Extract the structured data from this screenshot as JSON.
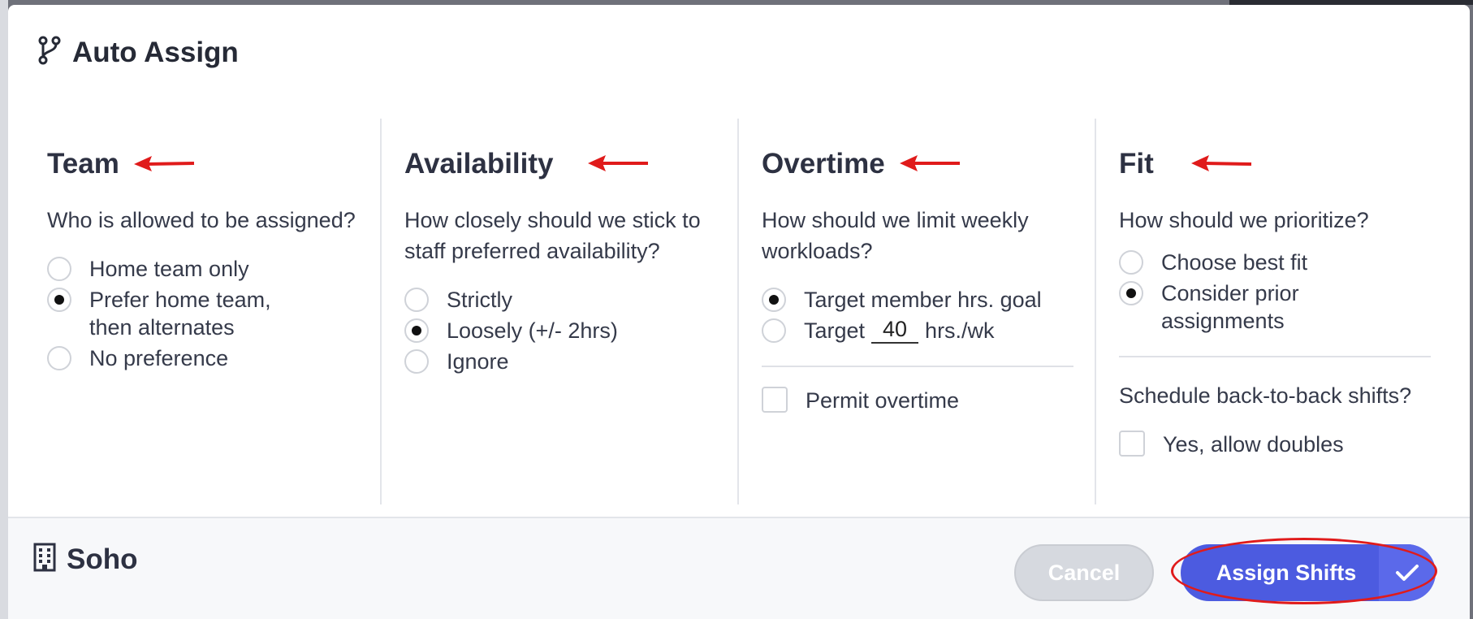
{
  "dialog": {
    "title": "Auto Assign",
    "title_icon": "branch-icon"
  },
  "columns": {
    "team": {
      "heading": "Team",
      "question": "Who is allowed to be assigned?",
      "options": [
        {
          "label": "Home team only",
          "checked": false
        },
        {
          "label": "Prefer home team, then alternates",
          "checked": true
        },
        {
          "label": "No preference",
          "checked": false
        }
      ]
    },
    "availability": {
      "heading": "Availability",
      "question": "How closely should we stick to staff preferred availability?",
      "options": [
        {
          "label": "Strictly",
          "checked": false
        },
        {
          "label": "Loosely (+/- 2hrs)",
          "checked": true
        },
        {
          "label": "Ignore",
          "checked": false
        }
      ]
    },
    "overtime": {
      "heading": "Overtime",
      "question": "How should we limit weekly workloads?",
      "options": [
        {
          "label": "Target member hrs. goal",
          "checked": true
        },
        {
          "label_before": "Target",
          "value": "40",
          "label_after": "hrs./wk",
          "checked": false
        }
      ],
      "permit_overtime": {
        "label": "Permit overtime",
        "checked": false
      }
    },
    "fit": {
      "heading": "Fit",
      "question": "How should we prioritize?",
      "options": [
        {
          "label": "Choose best fit",
          "checked": false
        },
        {
          "label": "Consider prior assignments",
          "checked": true
        }
      ],
      "doubles_question": "Schedule back-to-back shifts?",
      "allow_doubles": {
        "label": "Yes, allow doubles",
        "checked": false
      }
    }
  },
  "footer": {
    "location_icon": "building-icon",
    "location": "Soho",
    "cancel_label": "Cancel",
    "assign_label": "Assign Shifts",
    "assign_icon": "checkmark-icon"
  },
  "colors": {
    "primary": "#4c5be0",
    "annotation_red": "#e01b1b",
    "cancel_disabled": "#d6d9df"
  }
}
